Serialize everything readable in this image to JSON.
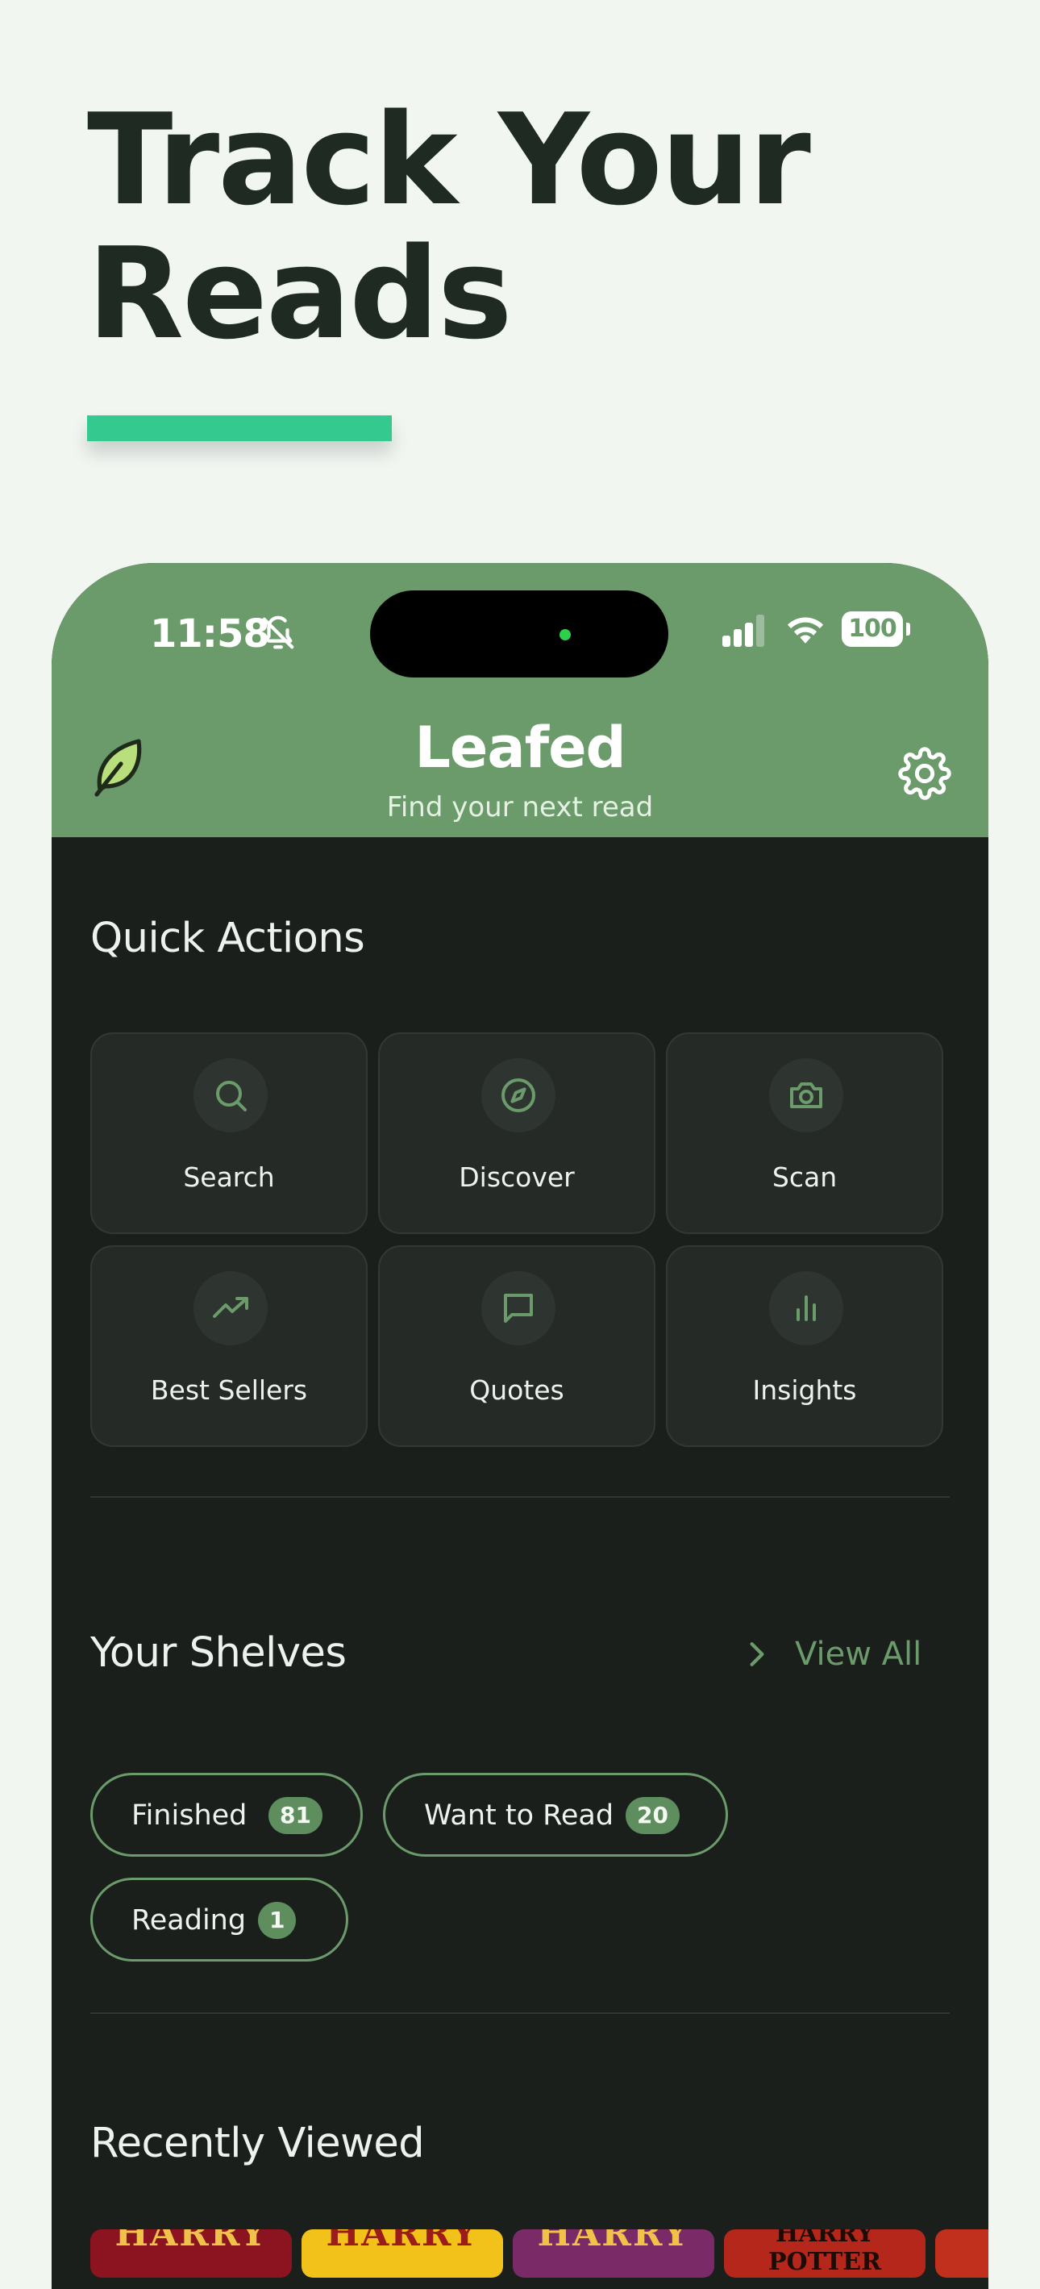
{
  "hero": {
    "headline": "Track Your\nReads",
    "accent_color": "#34c98f"
  },
  "status_bar": {
    "time": "11:58",
    "battery": "100"
  },
  "app_header": {
    "title": "Leafed",
    "subtitle": "Find your next read",
    "brand_color": "#6b9b6b"
  },
  "quick_actions": {
    "title": "Quick Actions",
    "items": [
      {
        "label": "Search",
        "icon": "search-icon"
      },
      {
        "label": "Discover",
        "icon": "compass-icon"
      },
      {
        "label": "Scan",
        "icon": "camera-icon"
      },
      {
        "label": "Best Sellers",
        "icon": "trending-up-icon"
      },
      {
        "label": "Quotes",
        "icon": "message-square-icon"
      },
      {
        "label": "Insights",
        "icon": "bar-chart-icon"
      }
    ]
  },
  "shelves": {
    "title": "Your Shelves",
    "view_all": "View All",
    "items": [
      {
        "label": "Finished",
        "count": "81"
      },
      {
        "label": "Want to Read",
        "count": "20"
      },
      {
        "label": "Reading",
        "count": "1"
      }
    ]
  },
  "recently_viewed": {
    "title": "Recently Viewed",
    "covers": [
      {
        "text": "HARRY",
        "bg": "#8c1420",
        "fg": "#f0c24a"
      },
      {
        "text": "HARRY",
        "bg": "#f2c21a",
        "fg": "#9c1c1c"
      },
      {
        "text": "HARRY",
        "bg": "#7a2a66",
        "fg": "#f0c24a"
      },
      {
        "text": "HARRY POTTER",
        "bg": "#b5271a",
        "fg": "#1b0c06"
      },
      {
        "text": "",
        "bg": "#c0301c",
        "fg": "#000000"
      }
    ]
  }
}
